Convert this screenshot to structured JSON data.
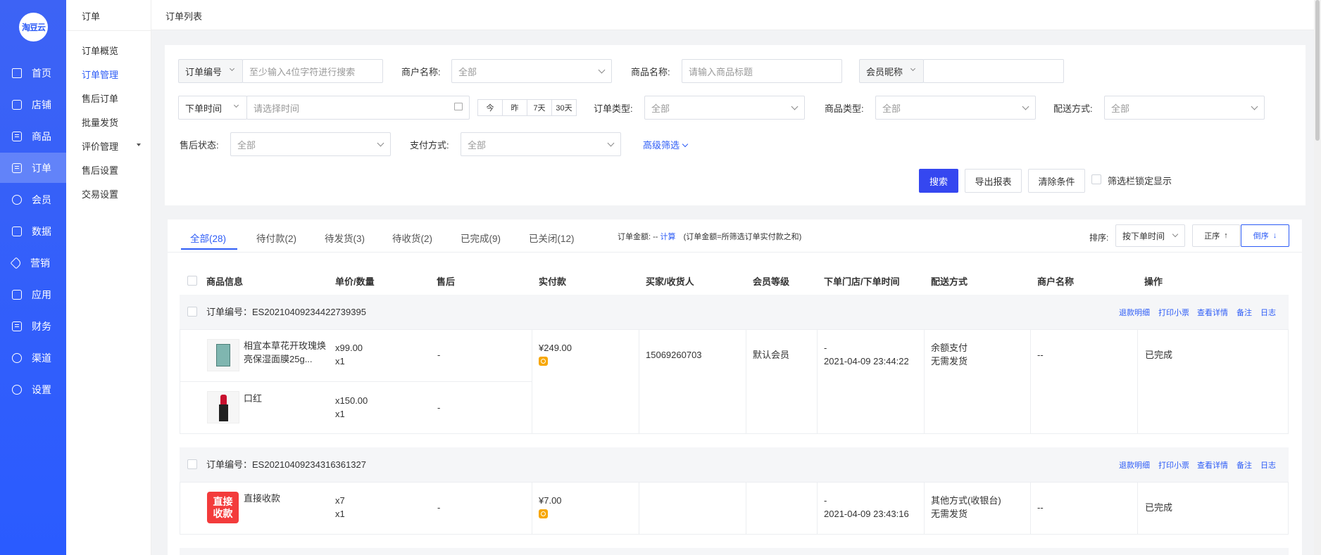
{
  "sidebar": {
    "logo": "淘豆云",
    "items": [
      {
        "label": "首页",
        "icon": "home-icon"
      },
      {
        "label": "店铺",
        "icon": "store-icon"
      },
      {
        "label": "商品",
        "icon": "goods-icon"
      },
      {
        "label": "订单",
        "icon": "order-icon"
      },
      {
        "label": "会员",
        "icon": "member-icon"
      },
      {
        "label": "数据",
        "icon": "data-icon"
      },
      {
        "label": "营销",
        "icon": "tag-icon"
      },
      {
        "label": "应用",
        "icon": "app-icon"
      },
      {
        "label": "财务",
        "icon": "finance-icon"
      },
      {
        "label": "渠道",
        "icon": "channel-icon"
      },
      {
        "label": "设置",
        "icon": "settings-icon"
      }
    ],
    "active_index": 3
  },
  "subnav": {
    "title": "订单",
    "items": [
      "订单概览",
      "订单管理",
      "售后订单",
      "批量发货",
      "评价管理",
      "售后设置",
      "交易设置"
    ],
    "active_index": 1
  },
  "header": {
    "breadcrumb": "订单列表"
  },
  "filters": {
    "order_no_select": "订单编号",
    "order_no_placeholder": "至少输入4位字符进行搜索",
    "merchant_label": "商户名称:",
    "merchant_value": "全部",
    "product_label": "商品名称:",
    "product_placeholder": "请输入商品标题",
    "member_select": "会员昵称",
    "member_value": "",
    "time_select": "下单时间",
    "time_placeholder": "请选择时间",
    "quick_days": [
      "今",
      "昨",
      "7天",
      "30天"
    ],
    "order_type_label": "订单类型:",
    "order_type_value": "全部",
    "goods_type_label": "商品类型:",
    "goods_type_value": "全部",
    "delivery_label": "配送方式:",
    "delivery_value": "全部",
    "aftersale_label": "售后状态:",
    "aftersale_value": "全部",
    "payment_label": "支付方式:",
    "payment_value": "全部",
    "advanced": "高级筛选",
    "search_btn": "搜索",
    "export_btn": "导出报表",
    "clear_btn": "清除条件",
    "lock_label": "筛选栏锁定显示"
  },
  "tabs": [
    "全部(28)",
    "待付款(2)",
    "待发货(3)",
    "待收货(2)",
    "已完成(9)",
    "已关闭(12)"
  ],
  "active_tab": 0,
  "summary": {
    "label": "订单金额:",
    "value": "--",
    "calc": "计算",
    "note": "(订单金额=所筛选订单实付款之和)"
  },
  "sort": {
    "label": "排序:",
    "value": "按下单时间",
    "asc": "正序",
    "desc": "倒序"
  },
  "columns": [
    "商品信息",
    "单价/数量",
    "售后",
    "实付款",
    "买家/收货人",
    "会员等级",
    "下单门店/下单时间",
    "配送方式",
    "商户名称",
    "操作"
  ],
  "order_actions": [
    "退款明细",
    "打印小票",
    "查看详情",
    "备注",
    "日志"
  ],
  "orders": [
    {
      "order_no": "订单编号：ES20210409234422739395",
      "items": [
        {
          "name": "相宜本草花开玫瑰焕亮保湿面膜25g...",
          "price": "x99.00",
          "qty": "x1",
          "aftersale": "-"
        },
        {
          "name": "口红",
          "price": "x150.00",
          "qty": "x1",
          "aftersale": "-"
        }
      ],
      "paid": "¥249.00",
      "buyer": "15069260703",
      "level": "默认会员",
      "store": "-",
      "time": "2021-04-09 23:44:22",
      "delivery1": "余额支付",
      "delivery2": "无需发货",
      "merchant": "--",
      "status": "已完成"
    },
    {
      "order_no": "订单编号：ES20210409234316361327",
      "items": [
        {
          "name": "直接收款",
          "price": "x7",
          "qty": "x1",
          "aftersale": "-",
          "badge": "直接收款"
        }
      ],
      "paid": "¥7.00",
      "buyer": "",
      "level": "",
      "store": "-",
      "time": "2021-04-09 23:43:16",
      "delivery1": "其他方式(收银台)",
      "delivery2": "无需发货",
      "merchant": "--",
      "status": "已完成"
    }
  ],
  "colors": {
    "sidebar": "#2d5cf6",
    "accent": "#2d5cf6",
    "primary_button": "#3547f0",
    "badge_red": "#f33b3b",
    "pay_icon": "#f7a700"
  }
}
